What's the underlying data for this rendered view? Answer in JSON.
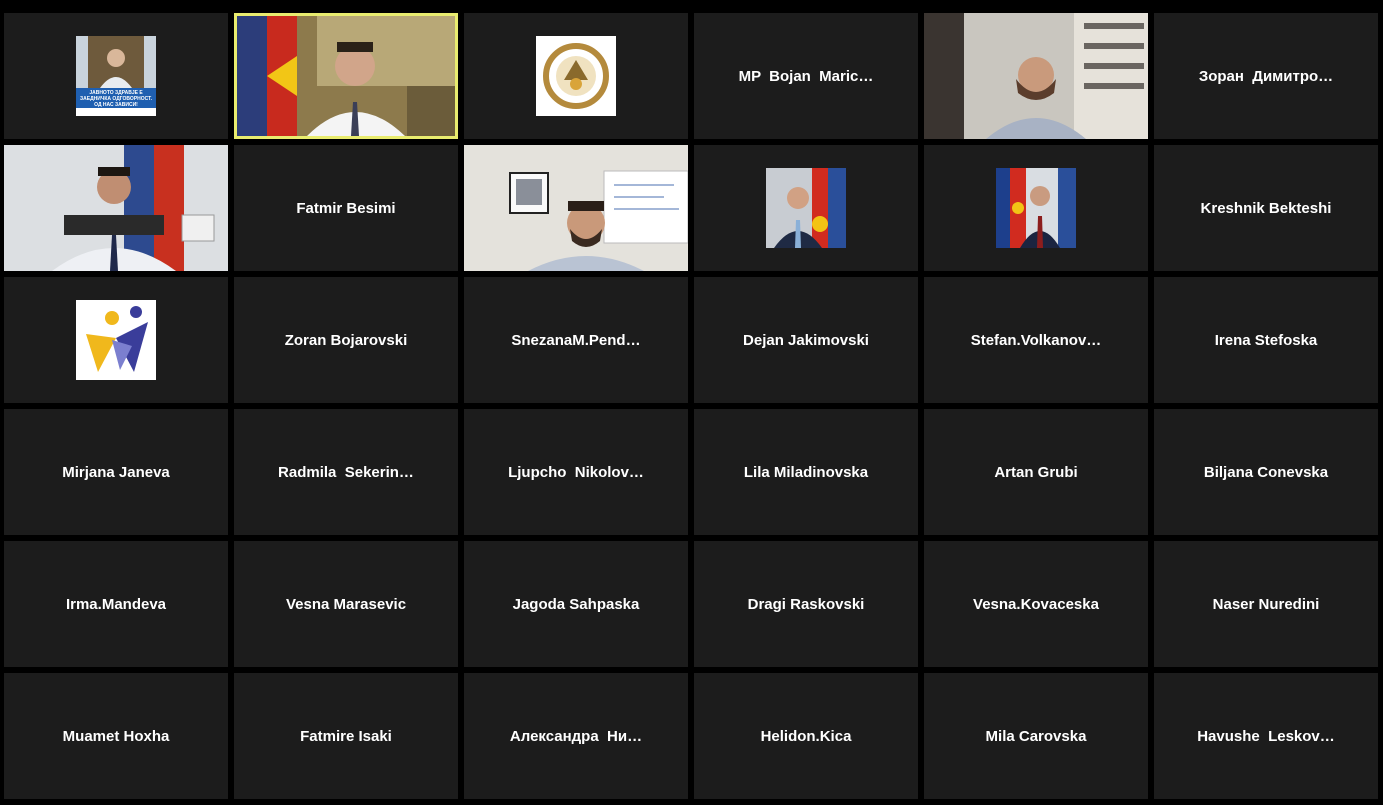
{
  "row1": {
    "t3_name": "MP  Bojan  Maric…",
    "t5_name": "Зоран  Димитро…",
    "t0_caption": "ЈАВНОТО ЗДРАВЈЕ Е ЗАЕДНИЧКА ОДГОВОРНОСТ. ОД НАС ЗАВИСИ!"
  },
  "row2": {
    "t1_name": "Fatmir Besimi",
    "t5_name": "Kreshnik Bekteshi"
  },
  "row3": {
    "t1_name": "Zoran Bojarovski",
    "t2_name": "SnezanaM.Pend…",
    "t3_name": "Dejan Jakimovski",
    "t4_name": "Stefan.Volkanov…",
    "t5_name": "Irena Stefoska"
  },
  "row4": [
    "Mirjana Janeva",
    "Radmila  Sekerin…",
    "Ljupcho  Nikolov…",
    "Lila Miladinovska",
    "Artan Grubi",
    "Biljana Conevska"
  ],
  "row5": [
    "Irma.Mandeva",
    "Vesna Marasevic",
    "Jagoda Sahpaska",
    "Dragi Raskovski",
    "Vesna.Kovaceska",
    "Naser Nuredini"
  ],
  "row6": [
    "Muamet Hoxha",
    "Fatmire Isaki",
    "Александра  Ни…",
    "Helidon.Kica",
    "Mila Carovska",
    "Havushe  Leskov…"
  ],
  "colors": {
    "active_border": "#e9ec6f",
    "tile_bg": "#1c1c1c",
    "background": "#000000"
  }
}
